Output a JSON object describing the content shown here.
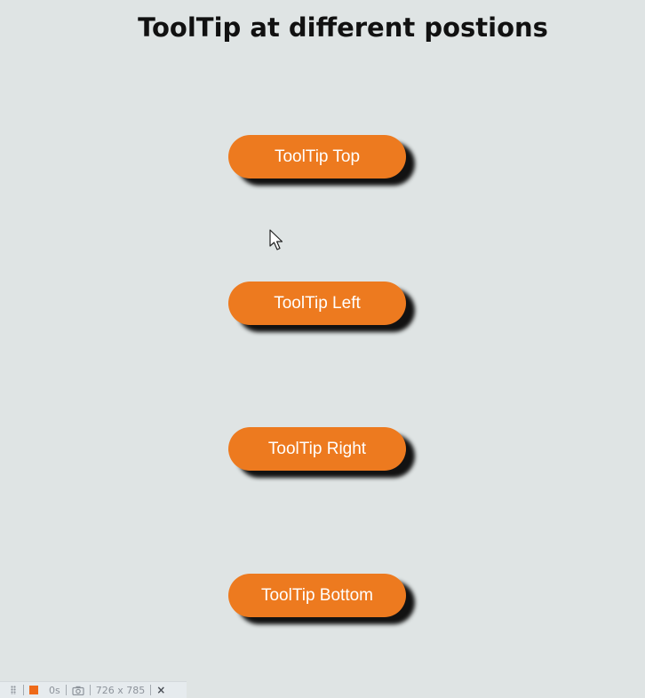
{
  "page": {
    "title": "ToolTip at different postions"
  },
  "buttons": {
    "top": "ToolTip Top",
    "left": "ToolTip Left",
    "right": "ToolTip Right",
    "bottom": "ToolTip Bottom"
  },
  "colors": {
    "background": "#dfe4e4",
    "button": "#ed7a1f",
    "button_text": "#ffffff",
    "shadow": "#121212"
  },
  "icons": {
    "cursor": "arrow-cursor-icon",
    "record": "record-square-icon",
    "camera": "camera-icon",
    "close": "close-icon"
  },
  "toolbar": {
    "timer": "0s",
    "dimensions": "726 x 785",
    "close_label": "×"
  }
}
